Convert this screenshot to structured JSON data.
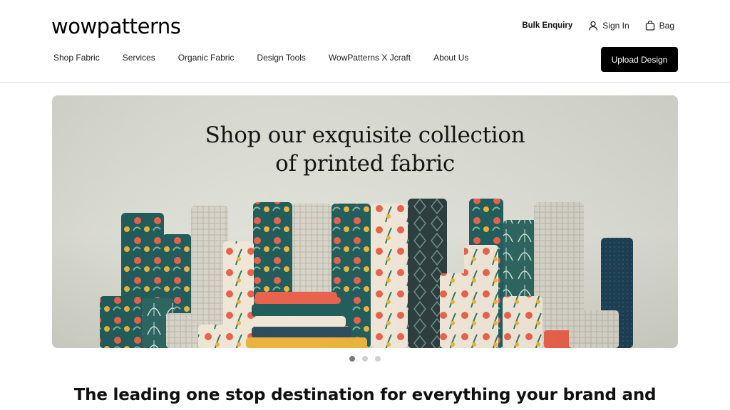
{
  "header": {
    "logo_text": "wowpatterns",
    "bulk_enquiry": "Bulk Enquiry",
    "sign_in": "Sign In",
    "bag": "Bag",
    "upload_design": "Upload Design"
  },
  "nav": {
    "items": [
      {
        "label": "Shop Fabric"
      },
      {
        "label": "Services"
      },
      {
        "label": "Organic Fabric"
      },
      {
        "label": "Design Tools"
      },
      {
        "label": "WowPatterns X Jcraft"
      },
      {
        "label": "About Us"
      }
    ]
  },
  "hero": {
    "title_line1": "Shop our exquisite collection",
    "title_line2": "of printed fabric",
    "slide_count": 3,
    "active_slide": 1
  },
  "tagline": "The leading one stop destination for everything your brand and",
  "colors": {
    "accent": "#000000",
    "teal": "#1f5b5a",
    "coral": "#e8604a",
    "mustard": "#e9b23a",
    "cream": "#efe6d6"
  },
  "icons": {
    "sign_in": "user-icon",
    "bag": "bag-icon"
  }
}
